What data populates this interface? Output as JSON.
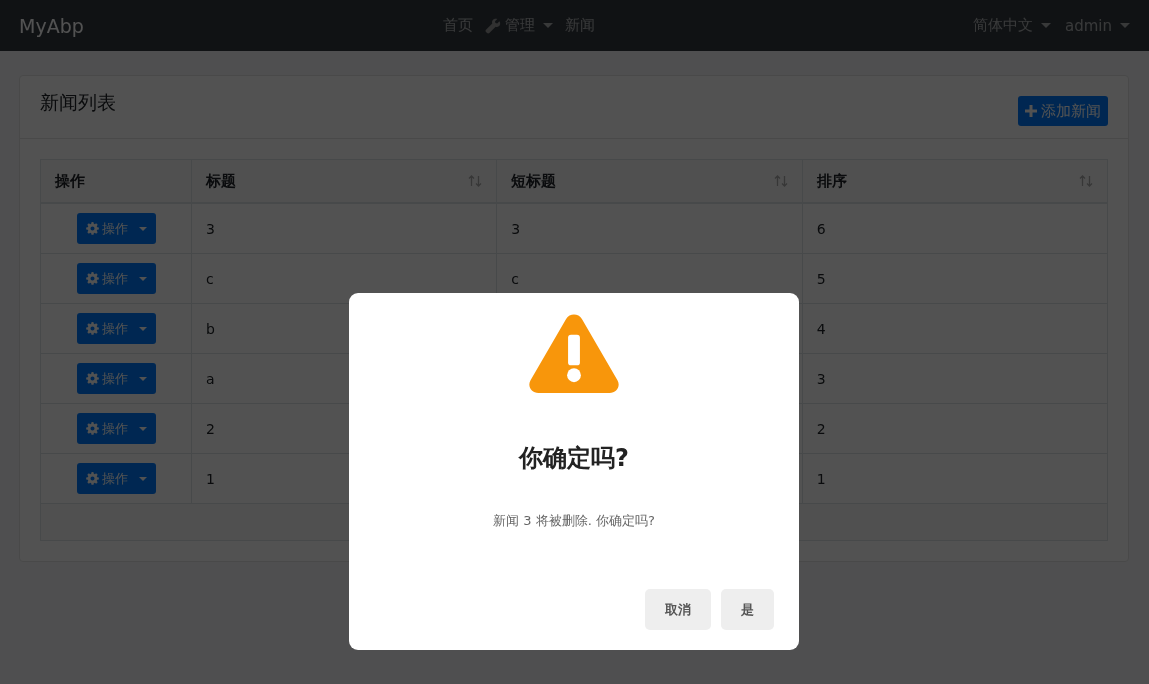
{
  "navbar": {
    "brand": "MyAbp",
    "links": [
      {
        "label": "首页",
        "kind": "link"
      },
      {
        "label": "管理",
        "kind": "dropdown"
      },
      {
        "label": "新闻",
        "kind": "link"
      }
    ],
    "right": [
      {
        "label": "简体中文"
      },
      {
        "label": "admin"
      }
    ]
  },
  "card": {
    "title": "新闻列表",
    "add_button": "添加新闻"
  },
  "table": {
    "columns": [
      {
        "label": "操作",
        "sortable": false
      },
      {
        "label": "标题",
        "sortable": true
      },
      {
        "label": "短标题",
        "sortable": true
      },
      {
        "label": "排序",
        "sortable": true
      }
    ],
    "rows": [
      {
        "action": "操作",
        "title": "3",
        "short_title": "3",
        "order": "6"
      },
      {
        "action": "操作",
        "title": "c",
        "short_title": "c",
        "order": "5"
      },
      {
        "action": "操作",
        "title": "b",
        "order": "4"
      },
      {
        "action": "操作",
        "title": "a",
        "order": "3"
      },
      {
        "action": "操作",
        "title": "2",
        "order": "2"
      },
      {
        "action": "操作",
        "title": "1",
        "order": "1"
      }
    ]
  },
  "dialog": {
    "title": "你确定吗?",
    "message": "新闻 3 将被删除. 你确定吗?",
    "buttons": [
      "取消",
      "是"
    ]
  }
}
